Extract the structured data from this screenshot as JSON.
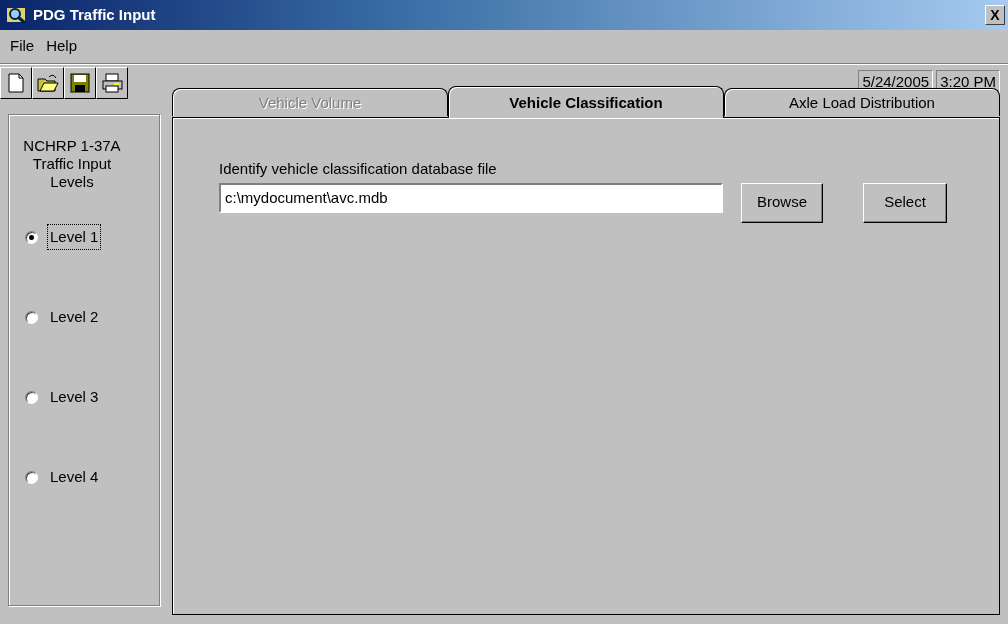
{
  "window": {
    "title": "PDG Traffic Input",
    "close": "X"
  },
  "menu": [
    {
      "label": "File"
    },
    {
      "label": "Help"
    }
  ],
  "toolbar": [
    {
      "kind": "new"
    },
    {
      "kind": "open"
    },
    {
      "kind": "save"
    },
    {
      "kind": "print"
    }
  ],
  "status": {
    "date": "5/24/2005",
    "time": "3:20 PM"
  },
  "levels": {
    "title": "NCHRP 1-37A\nTraffic Input\nLevels",
    "options": [
      {
        "label": "Level 1",
        "selected": true,
        "focused": true
      },
      {
        "label": "Level 2",
        "selected": false,
        "focused": false
      },
      {
        "label": "Level 3",
        "selected": false,
        "focused": false
      },
      {
        "label": "Level 4",
        "selected": false,
        "focused": false
      }
    ]
  },
  "tabs": [
    {
      "label": "Vehicle Volume",
      "selected": false,
      "disabled": true
    },
    {
      "label": "Vehicle Classification",
      "selected": true,
      "disabled": false
    },
    {
      "label": "Axle Load Distribution",
      "selected": false,
      "disabled": false
    }
  ],
  "file_field": {
    "label": "Identify vehicle classification database file",
    "value": "c:\\mydocument\\avc.mdb"
  },
  "buttons": [
    {
      "label": "Browse"
    },
    {
      "label": "Select"
    }
  ]
}
